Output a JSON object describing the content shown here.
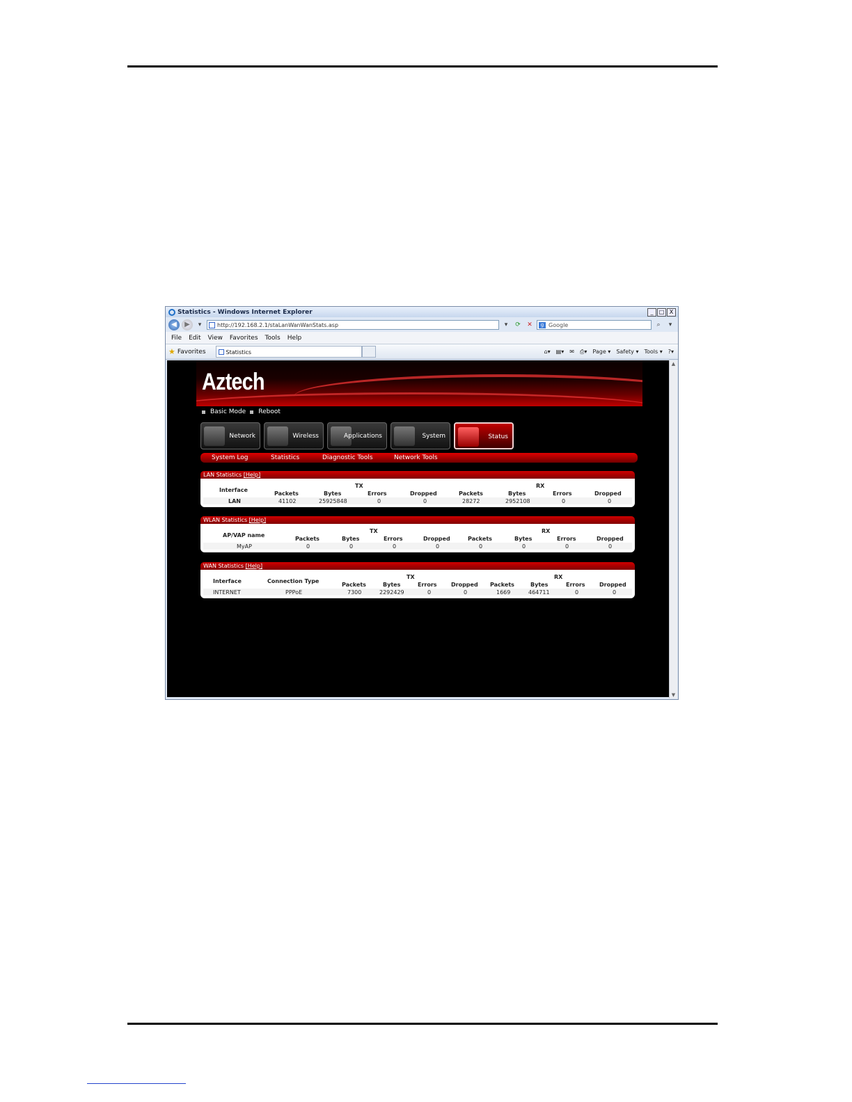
{
  "browser": {
    "title": "Statistics - Windows Internet Explorer",
    "controls": [
      "_",
      "□",
      "X"
    ],
    "url": "http://192.168.2.1/staLanWanWanStats.asp",
    "search_placeholder": "Google",
    "menu": [
      "File",
      "Edit",
      "View",
      "Favorites",
      "Tools",
      "Help"
    ],
    "favorites_label": "Favorites",
    "tab_label": "Statistics",
    "commands": [
      "Page ▾",
      "Safety ▾",
      "Tools ▾"
    ]
  },
  "router": {
    "logo": "Aztech",
    "quicklinks": [
      "Basic Mode",
      "Reboot"
    ],
    "nav": [
      "Network",
      "Wireless",
      "Applications",
      "System",
      "Status"
    ],
    "active_nav": "Status",
    "subnav": [
      "System Log",
      "Statistics",
      "Diagnostic Tools",
      "Network Tools"
    ]
  },
  "lan": {
    "title": "LAN Statistics",
    "help": "[Help]",
    "tx": "TX",
    "rx": "RX",
    "headers": [
      "Interface",
      "Packets",
      "Bytes",
      "Errors",
      "Dropped",
      "Packets",
      "Bytes",
      "Errors",
      "Dropped"
    ],
    "row": [
      "LAN",
      "41102",
      "25925848",
      "0",
      "0",
      "28272",
      "2952108",
      "0",
      "0"
    ]
  },
  "wlan": {
    "title": "WLAN Statistics",
    "help": "[Help]",
    "tx": "TX",
    "rx": "RX",
    "headers": [
      "AP/VAP name",
      "Packets",
      "Bytes",
      "Errors",
      "Dropped",
      "Packets",
      "Bytes",
      "Errors",
      "Dropped"
    ],
    "row": [
      "MyAP",
      "0",
      "0",
      "0",
      "0",
      "0",
      "0",
      "0",
      "0"
    ]
  },
  "wan": {
    "title": "WAN Statistics",
    "help": "[Help]",
    "tx": "TX",
    "rx": "RX",
    "headers": [
      "Interface",
      "Connection Type",
      "Packets",
      "Bytes",
      "Errors",
      "Dropped",
      "Packets",
      "Bytes",
      "Errors",
      "Dropped"
    ],
    "row": [
      "INTERNET",
      "PPPoE",
      "7300",
      "2292429",
      "0",
      "0",
      "1669",
      "464711",
      "0",
      "0"
    ]
  }
}
